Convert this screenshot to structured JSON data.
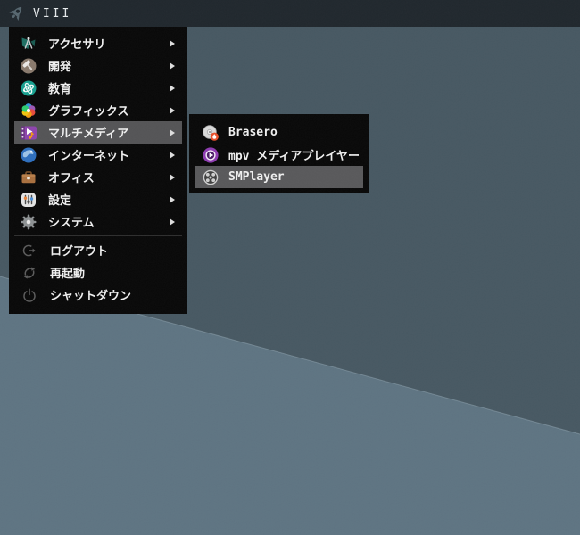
{
  "topbar": {
    "title": "VIII"
  },
  "menu": {
    "categories": [
      {
        "label": "アクセサリ",
        "icon": "accessories-icon",
        "selected": false
      },
      {
        "label": "開発",
        "icon": "development-icon",
        "selected": false
      },
      {
        "label": "教育",
        "icon": "education-icon",
        "selected": false
      },
      {
        "label": "グラフィックス",
        "icon": "graphics-icon",
        "selected": false
      },
      {
        "label": "マルチメディア",
        "icon": "multimedia-icon",
        "selected": true
      },
      {
        "label": "インターネット",
        "icon": "internet-icon",
        "selected": false
      },
      {
        "label": "オフィス",
        "icon": "office-icon",
        "selected": false
      },
      {
        "label": "設定",
        "icon": "settings-icon",
        "selected": false
      },
      {
        "label": "システム",
        "icon": "system-icon",
        "selected": false
      }
    ],
    "session": [
      {
        "label": "ログアウト",
        "icon": "logout-icon"
      },
      {
        "label": "再起動",
        "icon": "restart-icon"
      },
      {
        "label": "シャットダウン",
        "icon": "shutdown-icon"
      }
    ]
  },
  "submenu": {
    "items": [
      {
        "label": "Brasero",
        "icon": "brasero-icon",
        "selected": false
      },
      {
        "label": "mpv メディアプレイヤー",
        "icon": "mpv-icon",
        "selected": false
      },
      {
        "label": "SMPlayer",
        "icon": "smplayer-icon",
        "selected": true
      }
    ]
  },
  "colors": {
    "desktop-dark": "#475862",
    "desktop-light": "#5e7482",
    "topbar-bg": "#20272d",
    "menu-bg": "#080808",
    "highlight": "#545456",
    "highlight-sub": "#59595b",
    "menu-text": "#f0f0f0",
    "separator": "#2e2e2e",
    "session-icon": "#5c5c5c",
    "multimedia-purple": "#8e44ad"
  }
}
